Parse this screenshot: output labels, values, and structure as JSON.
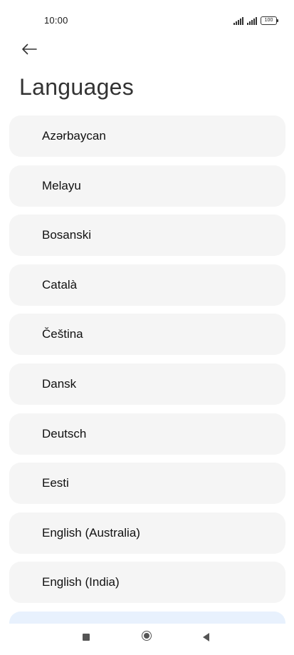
{
  "status_bar": {
    "time": "10:00",
    "battery": "100",
    "icons": [
      "signal-icon",
      "signal-icon",
      "battery-icon"
    ]
  },
  "header": {
    "back_icon": "arrow-left-icon",
    "title": "Languages"
  },
  "languages": [
    {
      "label": "Azərbaycan"
    },
    {
      "label": "Melayu"
    },
    {
      "label": "Bosanski"
    },
    {
      "label": "Català"
    },
    {
      "label": "Čeština"
    },
    {
      "label": "Dansk"
    },
    {
      "label": "Deutsch"
    },
    {
      "label": "Eesti"
    },
    {
      "label": "English (Australia)"
    },
    {
      "label": "English (India)"
    }
  ],
  "nav_bar": {
    "icons": [
      "recents-icon",
      "home-icon",
      "back-icon"
    ]
  },
  "colors": {
    "item_background": "#f5f5f5",
    "partial_item_background": "#e8f1fd",
    "title": "#333333"
  }
}
